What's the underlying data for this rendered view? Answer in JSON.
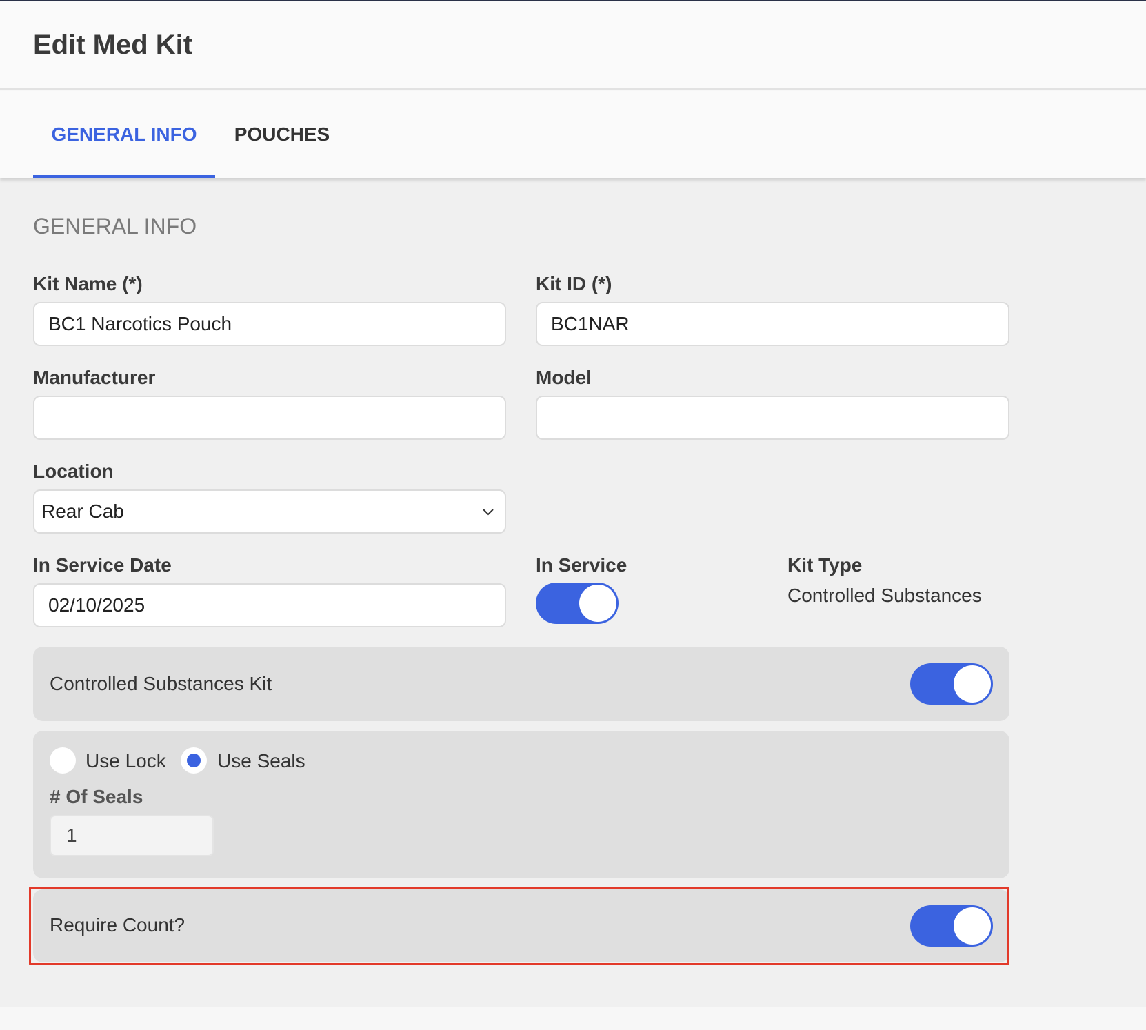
{
  "header": {
    "title": "Edit Med Kit"
  },
  "tabs": [
    {
      "label": "GENERAL INFO",
      "active": true
    },
    {
      "label": "POUCHES",
      "active": false
    }
  ],
  "section": {
    "title": "GENERAL INFO"
  },
  "form": {
    "kit_name": {
      "label": "Kit Name (*)",
      "value": "BC1 Narcotics Pouch"
    },
    "kit_id": {
      "label": "Kit ID (*)",
      "value": "BC1NAR"
    },
    "manufacturer": {
      "label": "Manufacturer",
      "value": ""
    },
    "model": {
      "label": "Model",
      "value": ""
    },
    "location": {
      "label": "Location",
      "value": "Rear Cab"
    },
    "in_service_date": {
      "label": "In Service Date",
      "value": "02/10/2025"
    },
    "in_service": {
      "label": "In Service",
      "on": true
    },
    "kit_type": {
      "label": "Kit Type",
      "value": "Controlled Substances"
    }
  },
  "controlled_substances": {
    "label": "Controlled Substances Kit",
    "on": true
  },
  "security": {
    "use_lock": {
      "label": "Use Lock",
      "checked": false
    },
    "use_seals": {
      "label": "Use Seals",
      "checked": true
    },
    "num_seals": {
      "label": "# Of Seals",
      "value": "1"
    }
  },
  "require_count": {
    "label": "Require Count?",
    "on": true
  },
  "colors": {
    "accent": "#3b63e0",
    "highlight": "#e23a2a"
  },
  "icons": {
    "location_dropdown": "chevron-down-icon"
  }
}
